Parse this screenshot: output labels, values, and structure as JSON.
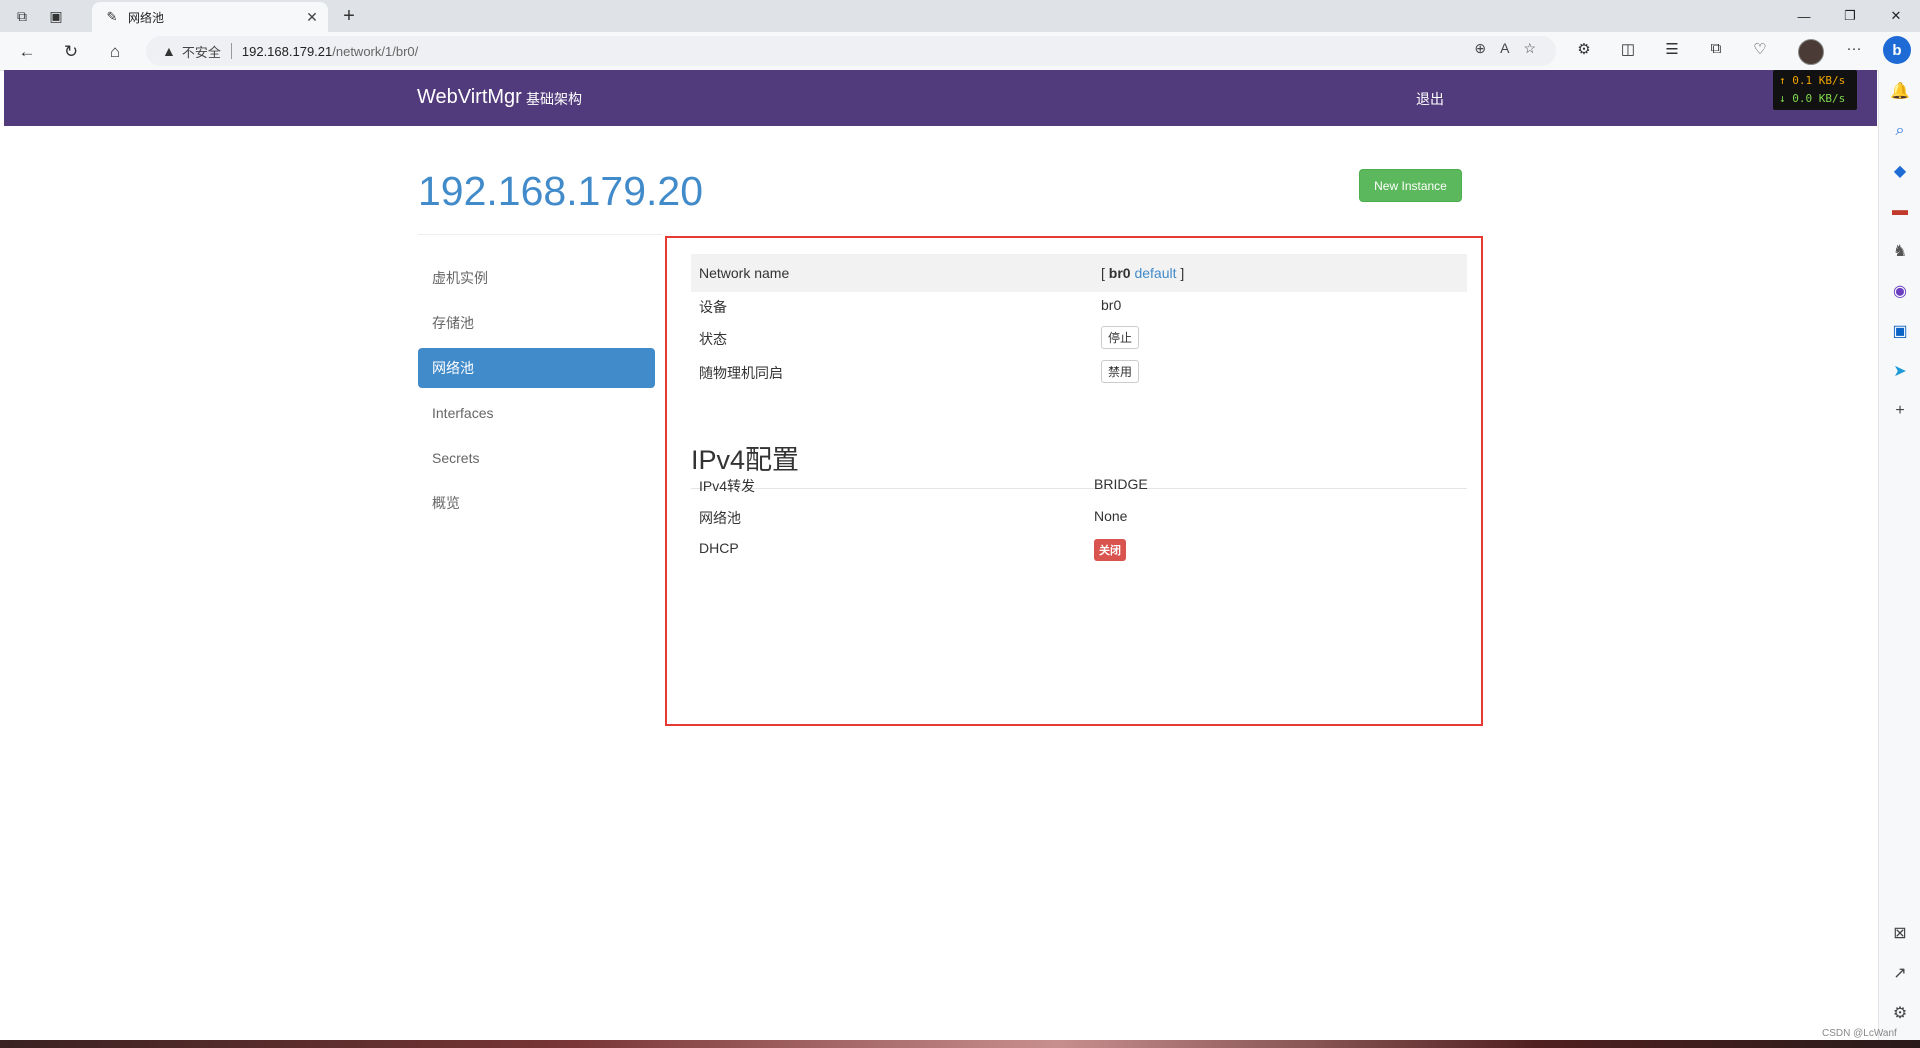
{
  "browser": {
    "tab_title": "网络池",
    "security_label": "不安全",
    "url_host": "192.168.179.21",
    "url_path": "/network/1/br0/",
    "net_up": "↑ 0.1 KB/s",
    "net_down": "↓ 0.0 KB/s"
  },
  "navbar": {
    "brand": "WebVirtMgr",
    "infra_link": "基础架构",
    "logout": "退出"
  },
  "page": {
    "host_title": "192.168.179.20",
    "new_instance_button": "New Instance"
  },
  "sidebar": {
    "items": [
      {
        "label": "虚机实例",
        "active": false
      },
      {
        "label": "存储池",
        "active": false
      },
      {
        "label": "网络池",
        "active": true
      },
      {
        "label": "Interfaces",
        "active": false
      },
      {
        "label": "Secrets",
        "active": false
      },
      {
        "label": "概览",
        "active": false
      }
    ]
  },
  "network": {
    "name_label": "Network name",
    "name_open_bracket": "[",
    "name_value": "br0",
    "name_link": "default",
    "name_close_bracket": "]",
    "device_label": "设备",
    "device_value": "br0",
    "state_label": "状态",
    "state_button": "停止",
    "autostart_label": "随物理机同启",
    "autostart_button": "禁用"
  },
  "ipv4": {
    "title": "IPv4配置",
    "forward_label": "IPv4转发",
    "forward_value": "BRIDGE",
    "pool_label": "网络池",
    "pool_value": "None",
    "dhcp_label": "DHCP",
    "dhcp_value": "关闭"
  },
  "watermark": "CSDN @LcWanf",
  "colors": {
    "navbar": "#523b7d",
    "primary": "#428bca",
    "success": "#5cb85c",
    "danger": "#d9534f",
    "highlight_border": "#e53935"
  }
}
